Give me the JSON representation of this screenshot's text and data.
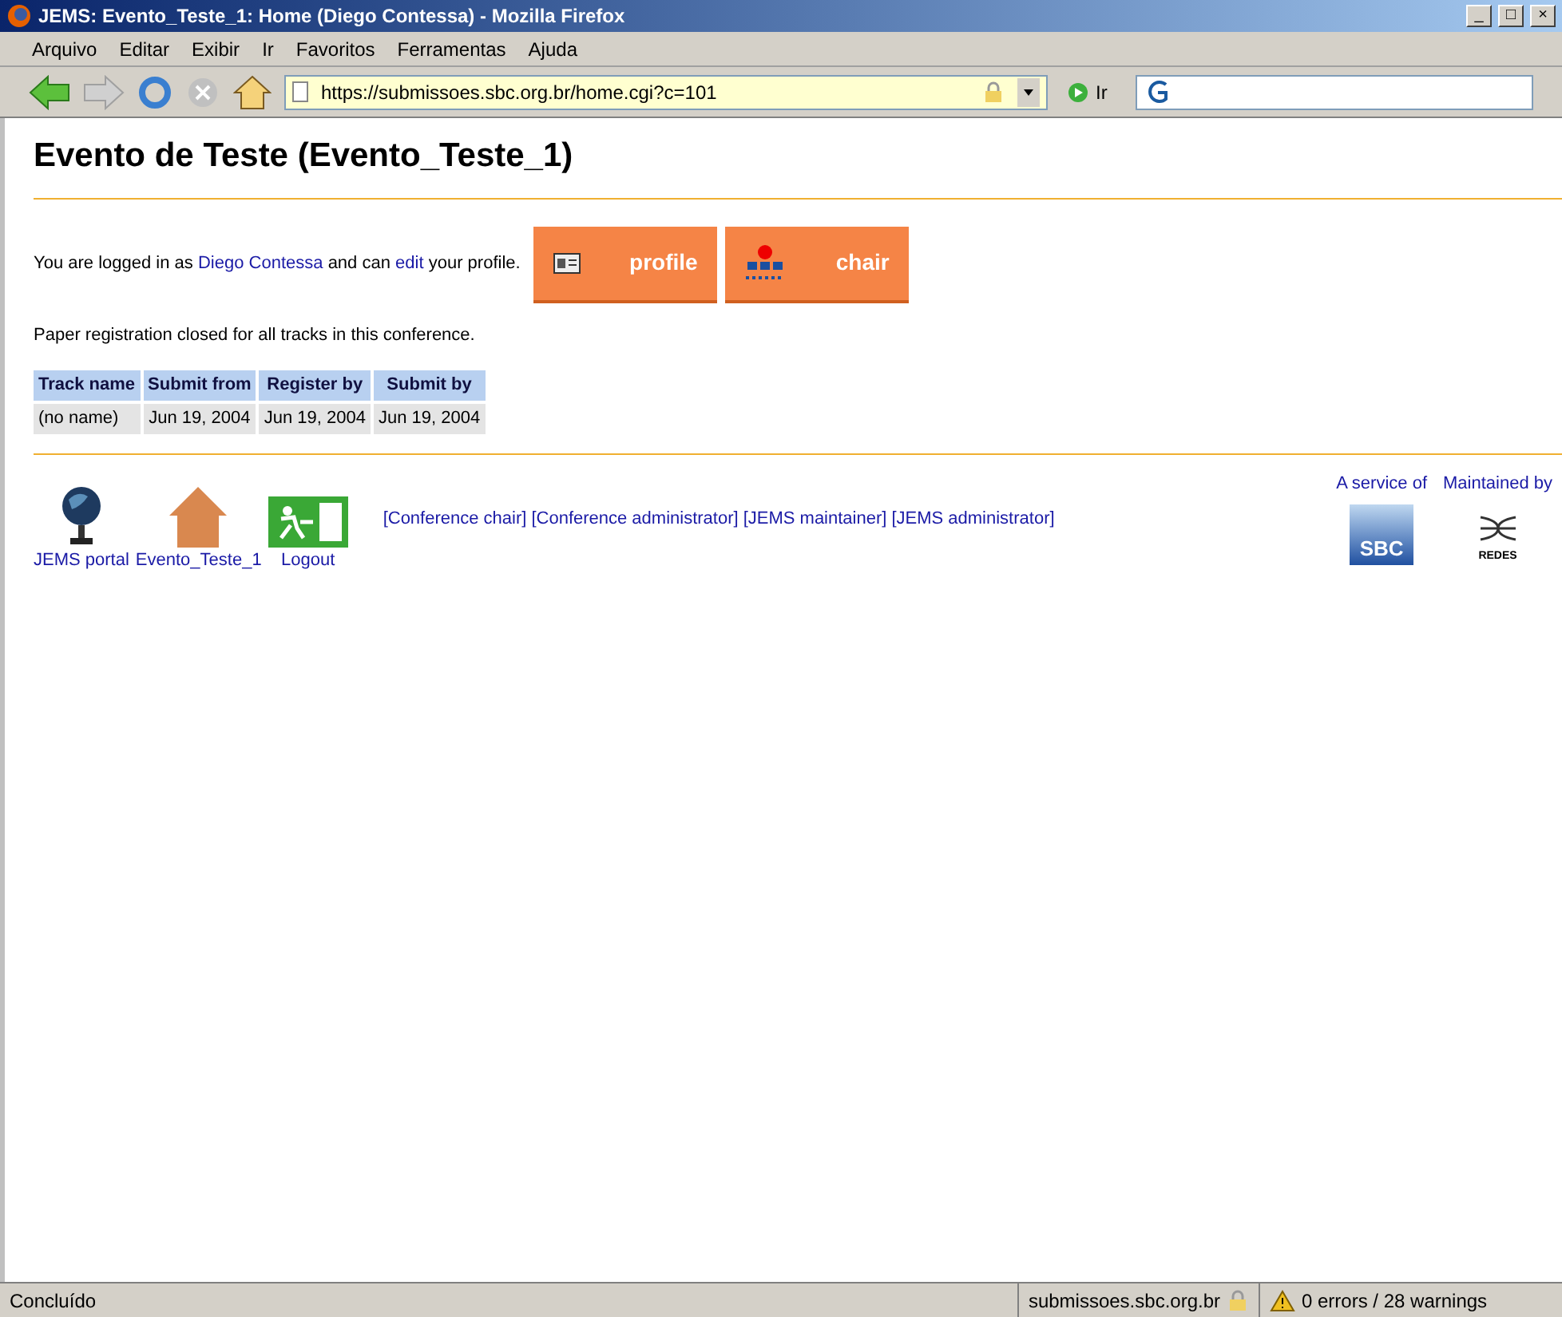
{
  "window": {
    "title": "JEMS: Evento_Teste_1: Home (Diego Contessa) - Mozilla Firefox",
    "controls": [
      "_",
      "□",
      "×"
    ]
  },
  "menu": [
    "Arquivo",
    "Editar",
    "Exibir",
    "Ir",
    "Favoritos",
    "Ferramentas",
    "Ajuda"
  ],
  "toolbar": {
    "url": "https://submissoes.sbc.org.br/home.cgi?c=101",
    "go": "Ir"
  },
  "page": {
    "heading": "Evento de Teste (Evento_Teste_1)",
    "login": {
      "before": "You are logged in as",
      "user": "Diego Contessa",
      "middle": "and can",
      "edit": "edit",
      "after": "your profile."
    },
    "buttons": [
      {
        "kind": "profile",
        "label": "profile"
      },
      {
        "kind": "chair",
        "label": "chair"
      }
    ],
    "notice": "Paper registration closed for all tracks in this conference.",
    "table": {
      "columns": [
        "Track name",
        "Submit from",
        "Register by",
        "Submit by"
      ],
      "rows": [
        [
          "(no name)",
          "Jun 19, 2004",
          "Jun 19, 2004",
          "Jun 19, 2004"
        ]
      ]
    },
    "footer_icons": [
      {
        "kind": "globe",
        "label": "JEMS portal"
      },
      {
        "kind": "house",
        "label": "Evento_Teste_1"
      },
      {
        "kind": "exit",
        "label": "Logout"
      }
    ],
    "footer_links": [
      "[Conference chair]",
      "[Conference administrator]",
      "[JEMS maintainer]",
      "[JEMS administrator]"
    ],
    "service": {
      "label": "A service of",
      "logo": "SBC"
    },
    "maintained": {
      "label": "Maintained by",
      "logo": "REDES"
    }
  },
  "status_bar": {
    "text": "Concluído",
    "host": "submissoes.sbc.org.br",
    "messages": "0 errors / 28 warnings"
  }
}
